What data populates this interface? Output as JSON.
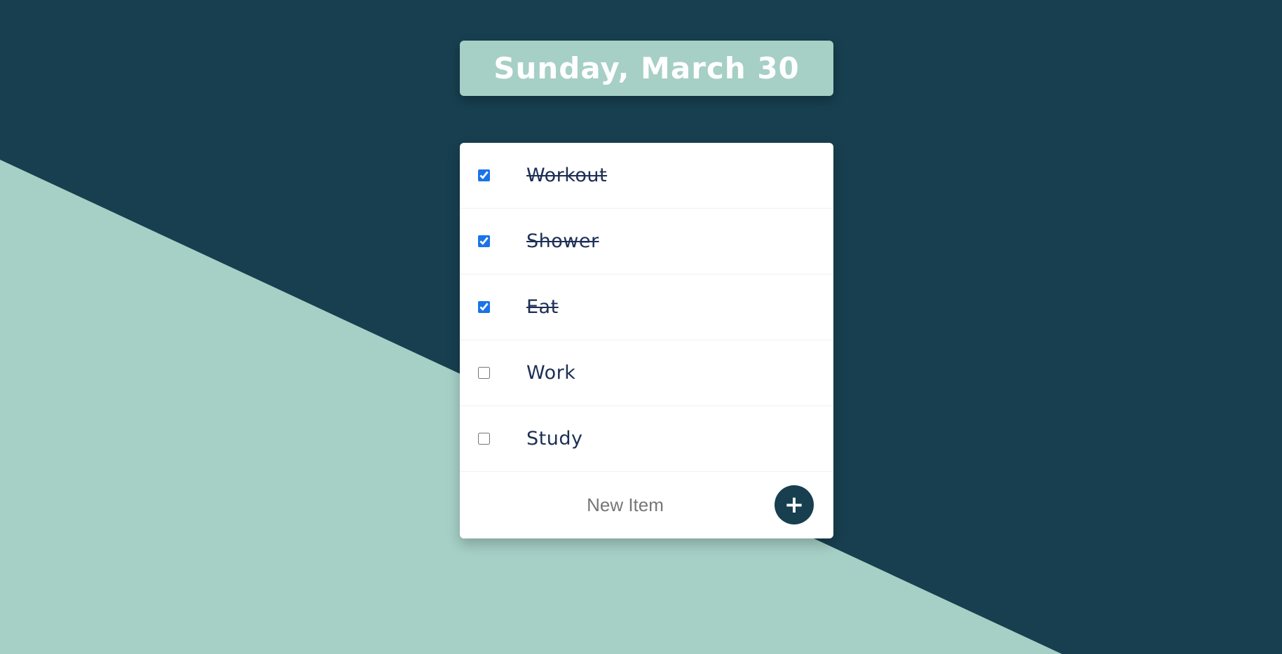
{
  "colors": {
    "background_dark": "#173f4f",
    "background_light": "#a6cfc6",
    "card": "#ffffff",
    "item_text": "#1d2f55",
    "checkbox_accent": "#1a73e8"
  },
  "header": {
    "date": "Sunday, March 30"
  },
  "items": [
    {
      "label": "Workout",
      "checked": true
    },
    {
      "label": "Shower",
      "checked": true
    },
    {
      "label": "Eat",
      "checked": true
    },
    {
      "label": "Work",
      "checked": false
    },
    {
      "label": "Study",
      "checked": false
    }
  ],
  "new_item": {
    "placeholder": "New Item",
    "value": "",
    "add_label": "+",
    "add_icon": "plus-icon"
  }
}
